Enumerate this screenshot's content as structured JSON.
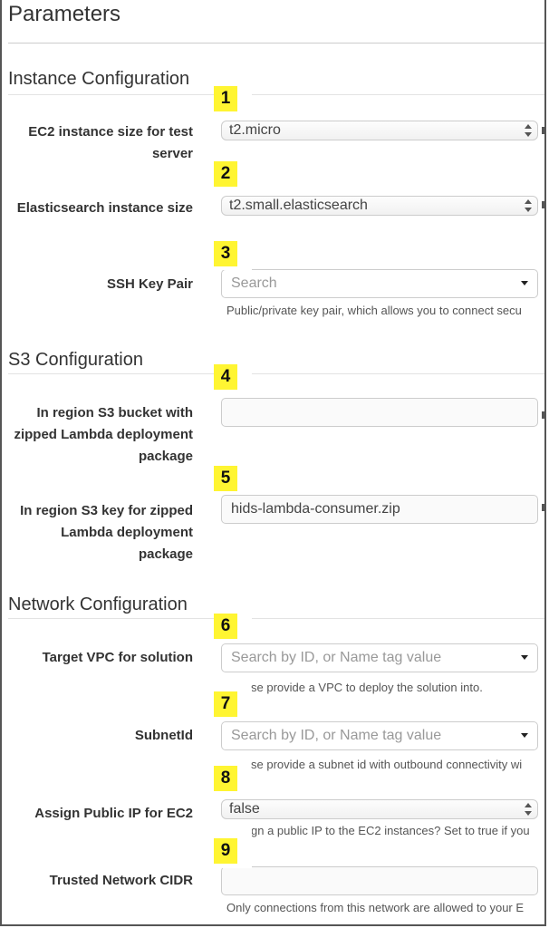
{
  "page": {
    "title": "Parameters"
  },
  "sections": [
    {
      "title": "Instance Configuration"
    },
    {
      "title": "S3 Configuration"
    },
    {
      "title": "Network Configuration"
    }
  ],
  "fields": [
    {
      "badge": "1",
      "label": "EC2 instance size for test server",
      "type": "select",
      "value": "t2.micro",
      "help": ""
    },
    {
      "badge": "2",
      "label": "Elasticsearch instance size",
      "type": "select",
      "value": "t2.small.elasticsearch",
      "help": ""
    },
    {
      "badge": "3",
      "label": "SSH Key Pair",
      "type": "search-select",
      "value": "",
      "placeholder": "Search",
      "help": "Public/private key pair, which allows you to connect secu"
    },
    {
      "badge": "4",
      "label": "In region S3 bucket with zipped Lambda deployment package",
      "type": "text",
      "value": "",
      "help": ""
    },
    {
      "badge": "5",
      "label": "In region S3 key for zipped Lambda deployment package",
      "type": "text",
      "value": "hids-lambda-consumer.zip",
      "help": ""
    },
    {
      "badge": "6",
      "label": "Target VPC for solution",
      "type": "search-select",
      "value": "",
      "placeholder": "Search by ID, or Name tag value",
      "help": "se provide a VPC to deploy the solution into."
    },
    {
      "badge": "7",
      "label": "SubnetId",
      "type": "search-select",
      "value": "",
      "placeholder": "Search by ID, or Name tag value",
      "help": "se provide a subnet id with outbound connectivity wi"
    },
    {
      "badge": "8",
      "label": "Assign Public IP for EC2",
      "type": "select",
      "value": "false",
      "help": "gn a public IP to the EC2 instances? Set to true if you"
    },
    {
      "badge": "9",
      "label": "Trusted Network CIDR",
      "type": "text",
      "value": "",
      "help": "Only connections from this network are allowed to your E"
    }
  ],
  "colors": {
    "badge": "#fff532",
    "border": "#cccccc",
    "text": "#333333"
  }
}
